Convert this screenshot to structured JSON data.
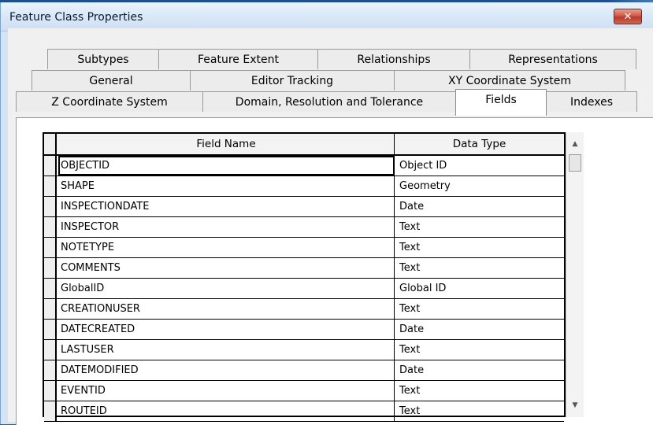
{
  "window": {
    "title": "Feature Class Properties",
    "close_glyph": "✕"
  },
  "tabs": {
    "row1": [
      "Subtypes",
      "Feature Extent",
      "Relationships",
      "Representations"
    ],
    "row2": [
      "General",
      "Editor Tracking",
      "XY Coordinate System"
    ],
    "row3": [
      "Z Coordinate System",
      "Domain, Resolution and Tolerance",
      "Fields",
      "Indexes"
    ],
    "active": "Fields"
  },
  "fields_table": {
    "headers": {
      "name": "Field Name",
      "type": "Data Type"
    },
    "rows": [
      {
        "name": "OBJECTID",
        "type": "Object ID"
      },
      {
        "name": "SHAPE",
        "type": "Geometry"
      },
      {
        "name": "INSPECTIONDATE",
        "type": "Date"
      },
      {
        "name": "INSPECTOR",
        "type": "Text"
      },
      {
        "name": "NOTETYPE",
        "type": "Text"
      },
      {
        "name": "COMMENTS",
        "type": "Text"
      },
      {
        "name": "GlobalID",
        "type": "Global ID"
      },
      {
        "name": "CREATIONUSER",
        "type": "Text"
      },
      {
        "name": "DATECREATED",
        "type": "Date"
      },
      {
        "name": "LASTUSER",
        "type": "Text"
      },
      {
        "name": "DATEMODIFIED",
        "type": "Date"
      },
      {
        "name": "EVENTID",
        "type": "Text"
      },
      {
        "name": "ROUTEID",
        "type": "Text"
      }
    ]
  },
  "scrollbar": {
    "up_icon": "▲",
    "down_icon": "▼"
  }
}
